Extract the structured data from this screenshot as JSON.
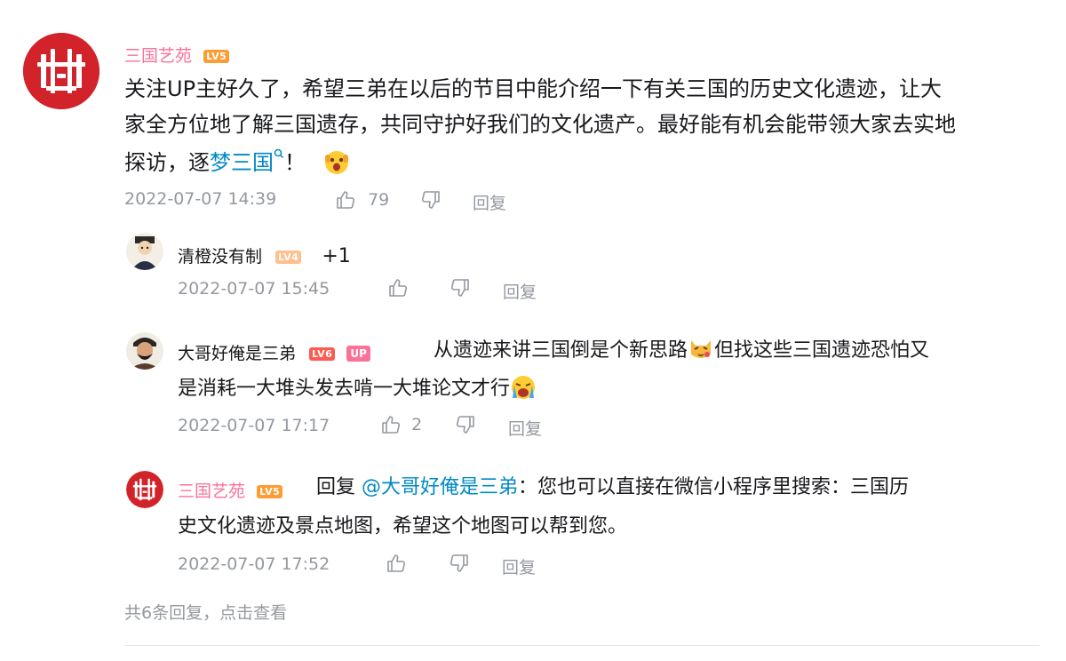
{
  "comment": {
    "username": "三国艺苑",
    "level": "LV5",
    "text_line1": "关注UP主好久了，希望三弟在以后的节目中能介绍一下有关三国的历史文化遗迹，让大",
    "text_line2": "家全方位地了解三国遗存，共同守护好我们的文化遗产。最好能有机会能带领大家去实地",
    "text_line3_pre": "探访，逐",
    "text_line3_link": "梦三国",
    "text_line3_post": "！",
    "time": "2022-07-07 14:39",
    "likes": "79",
    "reply_label": "回复"
  },
  "replies": [
    {
      "username": "清橙没有制",
      "level": "LV4",
      "text": "+1",
      "time": "2022-07-07 15:45",
      "likes": "",
      "reply_label": "回复"
    },
    {
      "username": "大哥好俺是三弟",
      "level": "LV6",
      "badge": "UP",
      "text_line1_pre": "从遗迹来讲三国倒是个新思路",
      "text_line1_post": "但找这些三国遗迹恐怕又",
      "text_line2": "是消耗一大堆头发去啃一大堆论文才行",
      "time": "2022-07-07 17:17",
      "likes": "2",
      "reply_label": "回复"
    },
    {
      "username": "三国艺苑",
      "level": "LV5",
      "reply_prefix": "回复",
      "mention": "@大哥好俺是三弟",
      "text_line1": "：您也可以直接在微信小程序里搜索：三国历",
      "text_line2": "史文化遗迹及景点地图，希望这个地图可以帮到您。",
      "time": "2022-07-07 17:52",
      "likes": "",
      "reply_label": "回复"
    }
  ],
  "footer": {
    "more_replies": "共6条回复，点击查看"
  },
  "colors": {
    "username_pink": "#fb7299",
    "link_blue": "#008ac5",
    "gray": "#9499a0",
    "avatar_red": "#d3232a"
  },
  "icons": [
    "like-icon",
    "dislike-icon",
    "search-icon",
    "emoji-surprised",
    "emoji-cat",
    "emoji-crying"
  ]
}
